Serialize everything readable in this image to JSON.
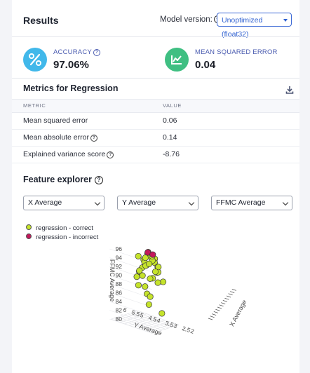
{
  "header": {
    "title": "Results",
    "model_version_label": "Model version:",
    "model_version_value": "Unoptimized (float32)"
  },
  "stats": {
    "accuracy": {
      "label": "ACCURACY",
      "value": "97.06%",
      "icon": "percent-icon",
      "color": "#41b8ea"
    },
    "mse": {
      "label": "MEAN SQUARED ERROR",
      "value": "0.04",
      "icon": "chart-icon",
      "color": "#3fbf82"
    }
  },
  "metrics": {
    "title": "Metrics for Regression",
    "columns": [
      "METRIC",
      "VALUE"
    ],
    "rows": [
      {
        "metric": "Mean squared error",
        "value": "0.06",
        "help": false
      },
      {
        "metric": "Mean absolute error",
        "value": "0.14",
        "help": true
      },
      {
        "metric": "Explained variance score",
        "value": "-8.76",
        "help": true
      }
    ]
  },
  "feature_explorer": {
    "title": "Feature explorer",
    "selects": [
      "X Average",
      "Y Average",
      "FFMC Average"
    ]
  },
  "chart_data": {
    "type": "scatter",
    "title": "",
    "xlabel": "X Average",
    "ylabel": "Y Average",
    "zlabel": "FFMC Average",
    "z_ticks": [
      "80",
      "82",
      "84",
      "86",
      "88",
      "90",
      "92",
      "94",
      "96"
    ],
    "y_ticks": [
      "6",
      "5.5",
      "5",
      "4.5",
      "4",
      "3.5",
      "3",
      "2.5",
      "2"
    ],
    "zlim": [
      80,
      96
    ],
    "series": [
      {
        "name": "regression - correct",
        "color": "#c5e32b",
        "points": [
          {
            "x": 4.1,
            "y": 3.4,
            "z": 95.2
          },
          {
            "x": 4.3,
            "y": 3.2,
            "z": 94.9
          },
          {
            "x": 4.5,
            "y": 3.6,
            "z": 95.0
          },
          {
            "x": 4.0,
            "y": 3.1,
            "z": 94.4
          },
          {
            "x": 4.6,
            "y": 3.0,
            "z": 94.2
          },
          {
            "x": 3.9,
            "y": 3.7,
            "z": 93.8
          },
          {
            "x": 4.8,
            "y": 3.3,
            "z": 93.6
          },
          {
            "x": 4.2,
            "y": 2.8,
            "z": 93.4
          },
          {
            "x": 4.4,
            "y": 3.9,
            "z": 93.1
          },
          {
            "x": 3.7,
            "y": 3.3,
            "z": 92.9
          },
          {
            "x": 5.0,
            "y": 3.1,
            "z": 92.7
          },
          {
            "x": 4.1,
            "y": 4.2,
            "z": 92.4
          },
          {
            "x": 4.7,
            "y": 2.6,
            "z": 92.2
          },
          {
            "x": 3.6,
            "y": 3.0,
            "z": 91.9
          },
          {
            "x": 5.2,
            "y": 3.5,
            "z": 91.7
          },
          {
            "x": 4.0,
            "y": 4.5,
            "z": 91.6
          },
          {
            "x": 4.9,
            "y": 2.9,
            "z": 91.3
          },
          {
            "x": 3.5,
            "y": 3.8,
            "z": 91.1
          },
          {
            "x": 4.3,
            "y": 2.5,
            "z": 90.8
          },
          {
            "x": 5.1,
            "y": 4.0,
            "z": 90.6
          },
          {
            "x": 3.8,
            "y": 4.6,
            "z": 90.3
          },
          {
            "x": 4.6,
            "y": 3.7,
            "z": 90.0
          },
          {
            "x": 3.4,
            "y": 3.2,
            "z": 89.6
          },
          {
            "x": 5.3,
            "y": 2.7,
            "z": 89.3
          },
          {
            "x": 4.2,
            "y": 4.9,
            "z": 88.8
          },
          {
            "x": 4.5,
            "y": 2.4,
            "z": 88.4
          },
          {
            "x": 3.9,
            "y": 3.5,
            "z": 87.6
          },
          {
            "x": 4.7,
            "y": 4.3,
            "z": 86.9
          },
          {
            "x": 4.1,
            "y": 3.0,
            "z": 85.2
          },
          {
            "x": 4.4,
            "y": 3.6,
            "z": 83.9
          },
          {
            "x": 4.8,
            "y": 2.2,
            "z": 81.5
          },
          {
            "x": 3.6,
            "y": 4.1,
            "z": 94.6
          },
          {
            "x": 5.0,
            "y": 4.4,
            "z": 94.0
          },
          {
            "x": 4.9,
            "y": 3.8,
            "z": 95.4
          },
          {
            "x": 3.8,
            "y": 2.9,
            "z": 95.1
          },
          {
            "x": 4.3,
            "y": 4.0,
            "z": 94.7
          }
        ]
      },
      {
        "name": "regression - incorrect",
        "color": "#c2185b",
        "points": [
          {
            "x": 4.2,
            "y": 3.5,
            "z": 95.6
          },
          {
            "x": 4.6,
            "y": 3.3,
            "z": 95.3
          }
        ]
      }
    ]
  }
}
